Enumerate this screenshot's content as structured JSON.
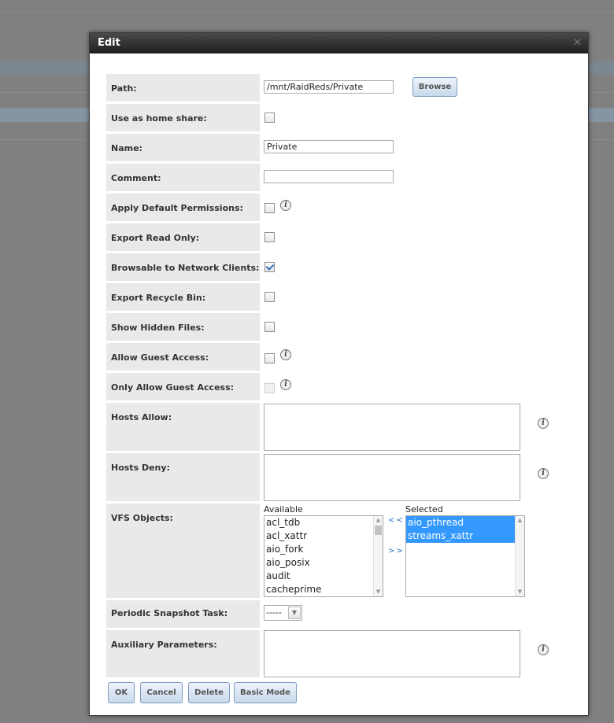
{
  "dialog": {
    "title": "Edit"
  },
  "fields": {
    "path": {
      "label": "Path:",
      "value": "/mnt/RaidReds/Private",
      "browse_label": "Browse"
    },
    "home_share": {
      "label": "Use as home share:"
    },
    "name": {
      "label": "Name:",
      "value": "Private"
    },
    "comment": {
      "label": "Comment:",
      "value": ""
    },
    "default_permissions": {
      "label": "Apply Default Permissions:"
    },
    "export_read_only": {
      "label": "Export Read Only:"
    },
    "browsable": {
      "label": "Browsable to Network Clients:",
      "checked": true
    },
    "recycle_bin": {
      "label": "Export Recycle Bin:"
    },
    "hidden_files": {
      "label": "Show Hidden Files:"
    },
    "guest_access": {
      "label": "Allow Guest Access:"
    },
    "only_guest": {
      "label": "Only Allow Guest Access:"
    },
    "hosts_allow": {
      "label": "Hosts Allow:"
    },
    "hosts_deny": {
      "label": "Hosts Deny:"
    },
    "vfs": {
      "label": "VFS Objects:",
      "available_caption": "Available",
      "selected_caption": "Selected",
      "move_left": "<<",
      "move_right": ">>",
      "available": [
        "acl_tdb",
        "acl_xattr",
        "aio_fork",
        "aio_posix",
        "audit",
        "cacheprime"
      ],
      "selected": [
        "aio_pthread",
        "streams_xattr"
      ]
    },
    "snapshot": {
      "label": "Periodic Snapshot Task:",
      "value": "-----"
    },
    "aux": {
      "label": "Auxiliary Parameters:"
    }
  },
  "buttons": {
    "ok": "OK",
    "cancel": "Cancel",
    "delete": "Delete",
    "basic_mode": "Basic Mode"
  },
  "colors": {
    "accent": "#3399ff",
    "titlebar": "#2a2a2a",
    "label_bg": "#e9e9e9"
  }
}
